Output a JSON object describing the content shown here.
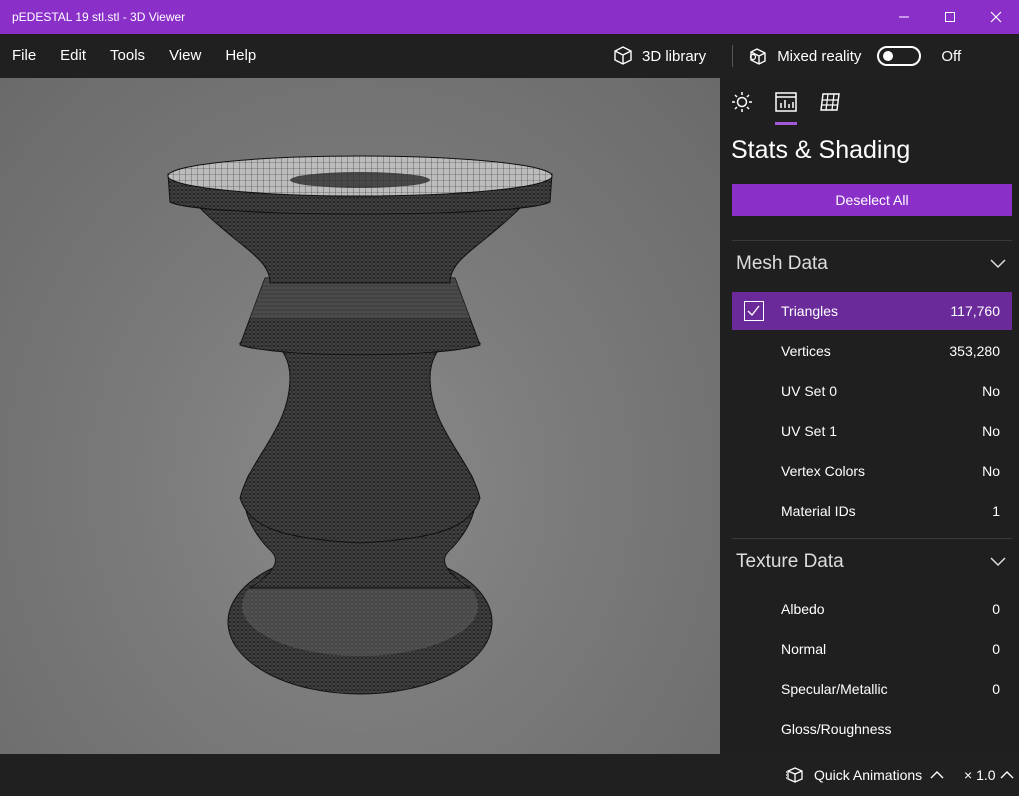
{
  "window": {
    "title": "pEDESTAL 19 stl.stl - 3D Viewer"
  },
  "menu": {
    "items": [
      "File",
      "Edit",
      "Tools",
      "View",
      "Help"
    ]
  },
  "toolbar": {
    "library_label": "3D library",
    "mixed_reality_label": "Mixed reality",
    "mixed_reality_state": "Off"
  },
  "panel": {
    "title": "Stats & Shading",
    "deselect_label": "Deselect All",
    "mesh": {
      "heading": "Mesh Data",
      "rows": [
        {
          "label": "Triangles",
          "value": "117,760"
        },
        {
          "label": "Vertices",
          "value": "353,280"
        },
        {
          "label": "UV Set 0",
          "value": "No"
        },
        {
          "label": "UV Set 1",
          "value": "No"
        },
        {
          "label": "Vertex Colors",
          "value": "No"
        },
        {
          "label": "Material IDs",
          "value": "1"
        }
      ]
    },
    "texture": {
      "heading": "Texture Data",
      "rows": [
        {
          "label": "Albedo",
          "value": "0"
        },
        {
          "label": "Normal",
          "value": "0"
        },
        {
          "label": "Specular/Metallic",
          "value": "0"
        },
        {
          "label": "Gloss/Roughness",
          "value": ""
        }
      ]
    }
  },
  "status": {
    "quick_animations": "Quick Animations",
    "zoom": "× 1.0"
  },
  "colors": {
    "accent": "#8b2fc9",
    "selected_row": "#6a2a9a"
  }
}
